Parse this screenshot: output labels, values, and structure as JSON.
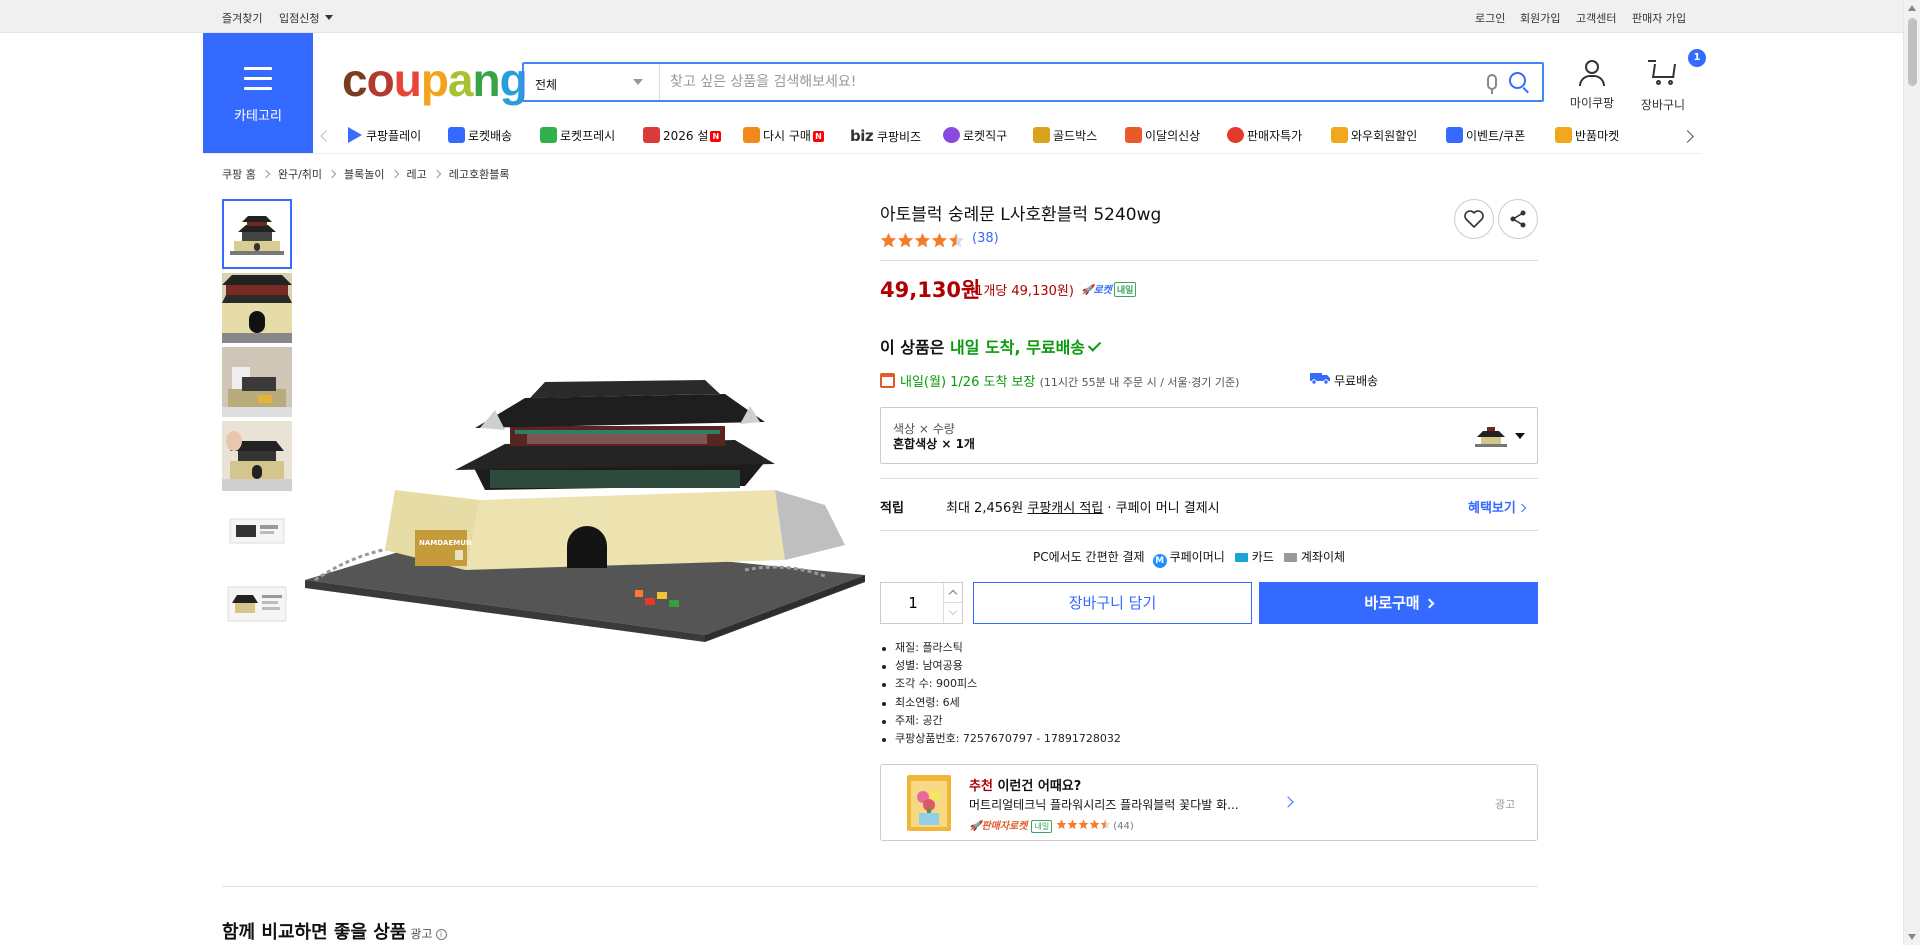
{
  "topbar": {
    "left": [
      "즐겨찾기",
      "입점신청"
    ],
    "right": [
      "로그인",
      "회원가입",
      "고객센터",
      "판매자 가입"
    ]
  },
  "header": {
    "category_label": "카테고리",
    "logo": [
      "c",
      "o",
      "u",
      "p",
      "a",
      "n",
      "g"
    ],
    "logo_colors": [
      "#7a3b1e",
      "#b33a2f",
      "#e8443a",
      "#f5a31a",
      "#a7c230",
      "#3aa34a",
      "#2a9ed8"
    ],
    "search": {
      "category": "전체",
      "placeholder": "찾고 싶은 상품을 검색해보세요!"
    },
    "mycoupang_label": "마이쿠팡",
    "cart_label": "장바구니",
    "cart_count": "1"
  },
  "nav": [
    {
      "label": "쿠팡플레이",
      "icon": "play-icon",
      "badge": ""
    },
    {
      "label": "로켓배송",
      "icon": "rocket-icon",
      "badge": ""
    },
    {
      "label": "로켓프레시",
      "icon": "rocket-fresh-icon",
      "badge": ""
    },
    {
      "label": "2026 설",
      "icon": "gift-icon",
      "badge": "N"
    },
    {
      "label": "다시 구매",
      "icon": "home-icon",
      "badge": "N"
    },
    {
      "label": "쿠팡비즈",
      "icon": "biz-icon",
      "badge": ""
    },
    {
      "label": "로켓직구",
      "icon": "global-icon",
      "badge": ""
    },
    {
      "label": "골드박스",
      "icon": "goldbox-icon",
      "badge": ""
    },
    {
      "label": "이달의신상",
      "icon": "bag-icon",
      "badge": ""
    },
    {
      "label": "판매자특가",
      "icon": "discount-icon",
      "badge": ""
    },
    {
      "label": "와우회원할인",
      "icon": "wow-icon",
      "badge": ""
    },
    {
      "label": "이벤트/쿠폰",
      "icon": "coupon-icon",
      "badge": ""
    },
    {
      "label": "반품마켓",
      "icon": "market-icon",
      "badge": ""
    }
  ],
  "nav_biz_prefix": "biz",
  "breadcrumb": [
    "쿠팡 홈",
    "완구/취미",
    "블록놀이",
    "레고",
    "레고호환블록"
  ],
  "product": {
    "title": "아토블럭 숭례문 L사호환블럭 5240wg",
    "rating_count": "(38)",
    "rating_stars": 4.5,
    "price": "49,130원",
    "unit_price": "(1개당 49,130원)",
    "rocket_label": "로켓",
    "rocket_tomorrow": "내일",
    "arrival_prefix": "이 상품은 ",
    "arrival_highlight": "내일 도착, 무료배송",
    "delivery_date": "내일(월) 1/26 도착 보장",
    "delivery_note": "(11시간 55분 내 주문 시 / 서울·경기 기준)",
    "free_shipping": "무료배송",
    "option_label": "색상 × 수량",
    "option_value": "혼합색상 × 1개",
    "cashback_key": "적립",
    "cashback_prefix": "최대 2,456원 ",
    "cashback_link": "쿠팡캐시 적립",
    "cashback_suffix": " · 쿠페이 머니 결제시",
    "benefit_link": "혜택보기",
    "pay_title": "PC에서도 간편한 결제",
    "pay_money": "쿠페이머니",
    "pay_card": "카드",
    "pay_bank": "계좌이체",
    "pay_money_icon": "M",
    "quantity": "1",
    "add_to_cart": "장바구니 담기",
    "buy_now": "바로구매",
    "specs": [
      "재질: 플라스틱",
      "성별: 남여공용",
      "조각 수: 900피스",
      "최소연령: 6세",
      "주제: 공간",
      "쿠팡상품번호: 7257670797 - 17891728032"
    ]
  },
  "recommend": {
    "prefix": "추천",
    "title": " 이런건 어때요?",
    "name": "머트리얼테크닉 플라워시리즈 플라워블럭 꽃다발 화...",
    "seller": "판매자로켓",
    "tomorrow": "내일",
    "rating_stars": 4.5,
    "count": "(44)",
    "ad": "광고"
  },
  "section": {
    "title": "함께 비교하면 좋을 상품",
    "ad": "광고",
    "info": "i"
  },
  "colors": {
    "accent": "#346aff",
    "price": "#ae0000",
    "green": "#0a9a0a"
  }
}
